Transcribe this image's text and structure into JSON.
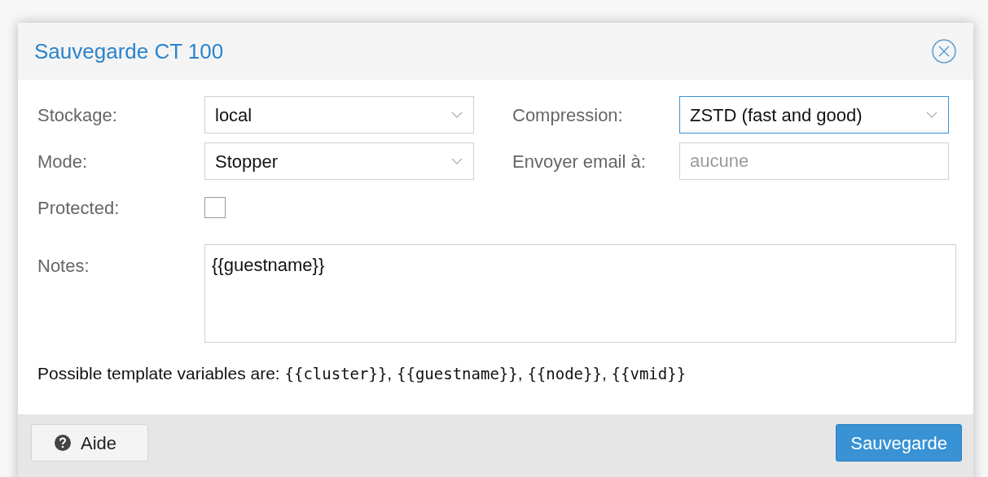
{
  "dialog": {
    "title": "Sauvegarde CT 100"
  },
  "fields_left": [
    {
      "label": "Stockage:",
      "kind": "select",
      "value": "local",
      "focused": false
    },
    {
      "label": "Mode:",
      "kind": "select",
      "value": "Stopper",
      "focused": false
    },
    {
      "label": "Protected:",
      "kind": "checkbox",
      "checked": false
    }
  ],
  "fields_right": [
    {
      "label": "Compression:",
      "kind": "select",
      "value": "ZSTD (fast and good)",
      "focused": true
    },
    {
      "label": "Envoyer email à:",
      "kind": "text",
      "placeholder": "aucune",
      "focused": false
    }
  ],
  "notes": {
    "label": "Notes:",
    "value": "{{guestname}}"
  },
  "hint": {
    "text": "Possible template variables are: ",
    "variables": [
      {
        "name": "{{cluster}}",
        "separator": ", "
      },
      {
        "name": "{{guestname}}",
        "separator": ", "
      },
      {
        "name": "{{node}}",
        "separator": ", "
      },
      {
        "name": "{{vmid}}"
      }
    ]
  },
  "footer": {
    "help_button": "Aide",
    "submit_button": "Sauvegarde"
  }
}
